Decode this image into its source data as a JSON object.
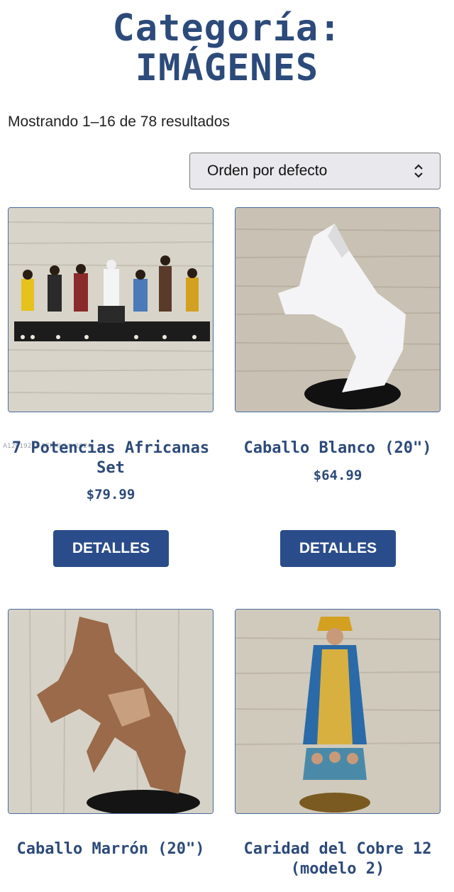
{
  "header": {
    "title_line1": "Categoría:",
    "title_line2": "IMÁGENES"
  },
  "results": {
    "count_text": "Mostrando 1–16 de 78 resultados"
  },
  "sort": {
    "selected": "Orden por defecto",
    "icon": "chevron-updown-icon"
  },
  "watermark": "A12019288  SEFMLS® 2024",
  "products": [
    {
      "title": "7 Potencias Africanas Set",
      "price": "$79.99",
      "button": "DETALLES"
    },
    {
      "title": "Caballo Blanco (20\")",
      "price": "$64.99",
      "button": "DETALLES"
    },
    {
      "title": "Caballo Marrón (20\")"
    },
    {
      "title": "Caridad del Cobre 12 (modelo 2)"
    }
  ],
  "colors": {
    "accent": "#2c4a7a",
    "button": "#2a4c8a"
  }
}
